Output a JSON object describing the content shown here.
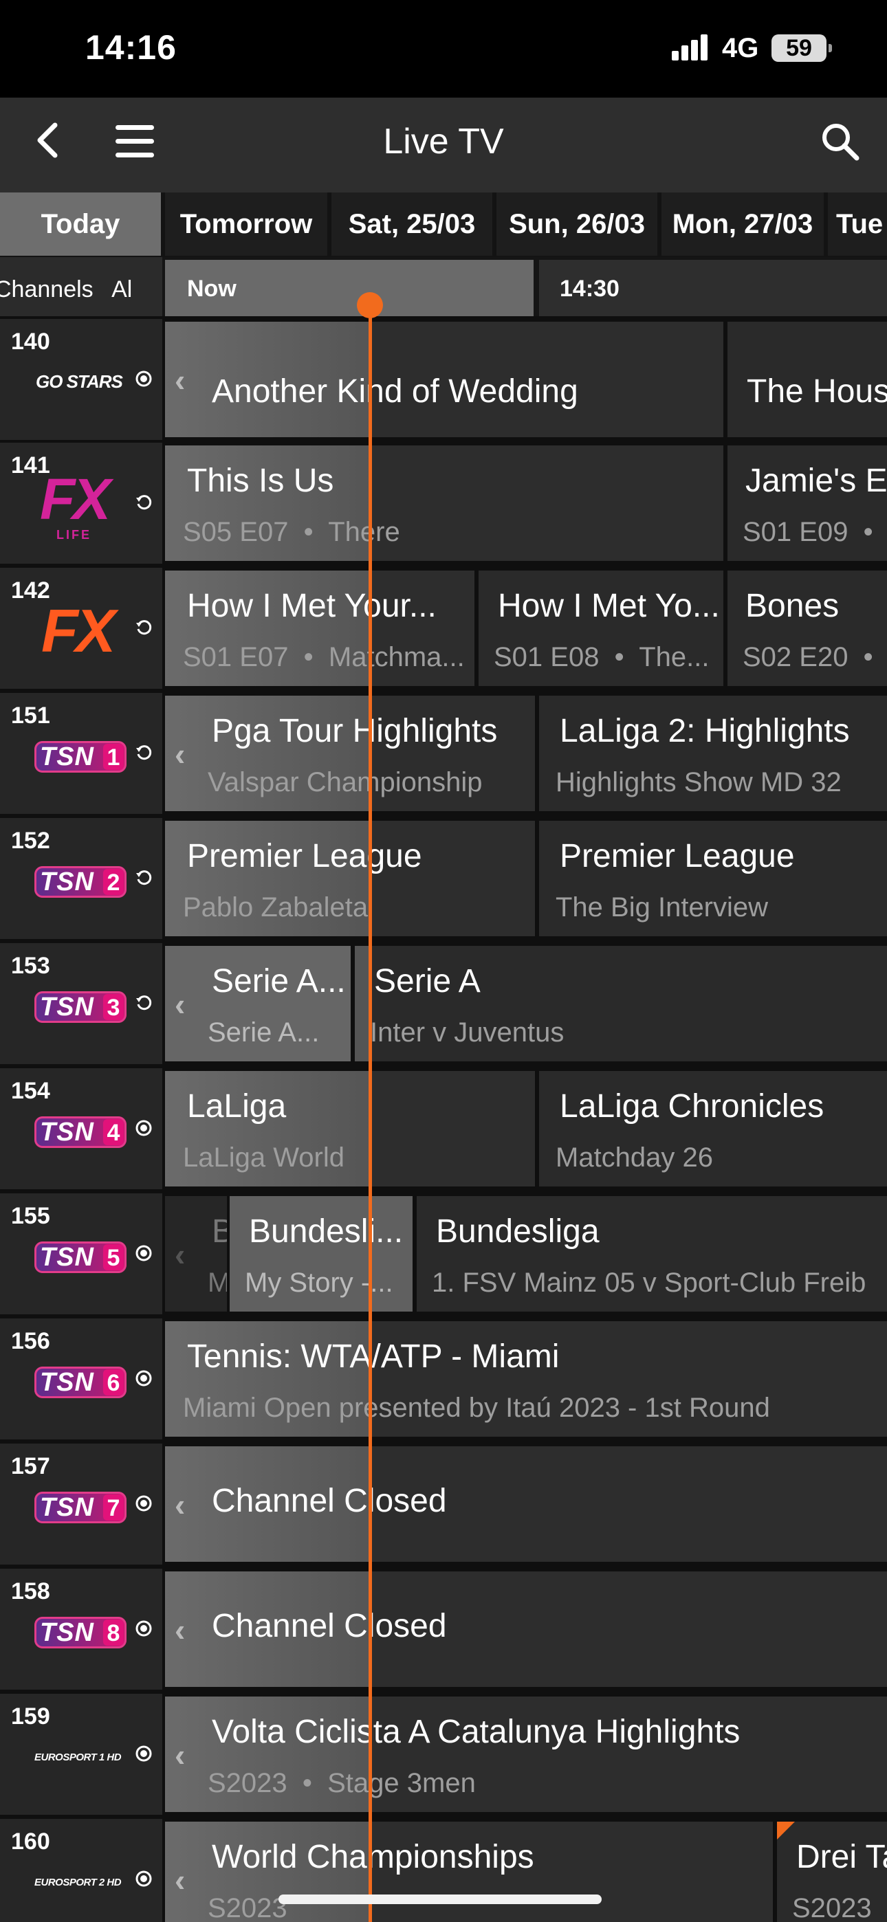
{
  "status": {
    "time": "14:16",
    "network": "4G",
    "battery": "59"
  },
  "nav": {
    "title": "Live TV"
  },
  "dates": [
    "Today",
    "Tomorrow",
    "Sat, 25/03",
    "Sun, 26/03",
    "Mon, 27/03",
    "Tue"
  ],
  "timebar": {
    "channels_label": "Channels   Al",
    "now_label": "Now",
    "next_time": "14:30"
  },
  "channels": [
    {
      "number": "140",
      "logo": "GO STARS",
      "indicator": "live-icon",
      "programs": [
        {
          "title": "Another Kind of Wedding",
          "subtitle": "",
          "arrow": true
        },
        {
          "title": "The Hous",
          "subtitle": ""
        }
      ]
    },
    {
      "number": "141",
      "logo": "FX LIFE",
      "indicator": "replay-icon",
      "programs": [
        {
          "title": "This Is Us",
          "subtitle": "S05 E07  •  There"
        },
        {
          "title": "Jamie's E",
          "subtitle": "S01 E09  •"
        }
      ]
    },
    {
      "number": "142",
      "logo": "FX",
      "indicator": "replay-icon",
      "programs": [
        {
          "title": "How I Met Your...",
          "subtitle": "S01 E07  •  Matchma..."
        },
        {
          "title": "How I Met Yo...",
          "subtitle": "S01 E08  •  The..."
        },
        {
          "title": "Bones",
          "subtitle": "S02 E20  •"
        }
      ]
    },
    {
      "number": "151",
      "logo": "TSN 1",
      "indicator": "replay-icon",
      "programs": [
        {
          "title": "Pga Tour Highlights",
          "subtitle": "Valspar Championship",
          "arrow": true
        },
        {
          "title": "LaLiga 2: Highlights",
          "subtitle": "Highlights Show MD 32"
        }
      ]
    },
    {
      "number": "152",
      "logo": "TSN 2",
      "indicator": "replay-icon",
      "programs": [
        {
          "title": "Premier League",
          "subtitle": "Pablo Zabaleta"
        },
        {
          "title": "Premier League",
          "subtitle": "The Big Interview"
        }
      ]
    },
    {
      "number": "153",
      "logo": "TSN 3",
      "indicator": "replay-icon",
      "programs": [
        {
          "title": "Serie A...",
          "subtitle": "Serie A...",
          "arrow": true
        },
        {
          "title": "Serie A",
          "subtitle": "Inter v Juventus"
        }
      ]
    },
    {
      "number": "154",
      "logo": "TSN 4",
      "indicator": "live-icon",
      "programs": [
        {
          "title": "LaLiga",
          "subtitle": "LaLiga World"
        },
        {
          "title": "LaLiga Chronicles",
          "subtitle": "Matchday 26"
        }
      ]
    },
    {
      "number": "155",
      "logo": "TSN 5",
      "indicator": "live-icon",
      "programs": [
        {
          "title": "B",
          "subtitle": "M",
          "arrow": true
        },
        {
          "title": "Bundesli...",
          "subtitle": "My Story -..."
        },
        {
          "title": "Bundesliga",
          "subtitle": "1. FSV Mainz 05 v Sport-Club Freib"
        }
      ]
    },
    {
      "number": "156",
      "logo": "TSN 6",
      "indicator": "live-icon",
      "programs": [
        {
          "title": "Tennis: WTA/ATP - Miami",
          "subtitle": "Miami Open presented by Itaú 2023 - 1st Round"
        }
      ]
    },
    {
      "number": "157",
      "logo": "TSN 7",
      "indicator": "live-icon",
      "programs": [
        {
          "title": "Channel Closed",
          "subtitle": "",
          "arrow": true
        }
      ]
    },
    {
      "number": "158",
      "logo": "TSN 8",
      "indicator": "live-icon",
      "programs": [
        {
          "title": "Channel Closed",
          "subtitle": "",
          "arrow": true
        }
      ]
    },
    {
      "number": "159",
      "logo": "EUROSPORT 1 HD",
      "indicator": "live-icon",
      "programs": [
        {
          "title": "Volta Ciclista A Catalunya Highlights",
          "subtitle": "S2023  •  Stage 3men",
          "arrow": true
        }
      ]
    },
    {
      "number": "160",
      "logo": "EUROSPORT 2 HD",
      "indicator": "live-icon",
      "programs": [
        {
          "title": "World Championships",
          "subtitle": "S2023",
          "arrow": true
        },
        {
          "title": "Drei Ta",
          "subtitle": "S2023"
        }
      ]
    }
  ],
  "colors": {
    "accent": "#f26b1d",
    "background": "#0f0f0f",
    "header": "#2e2e2e"
  }
}
